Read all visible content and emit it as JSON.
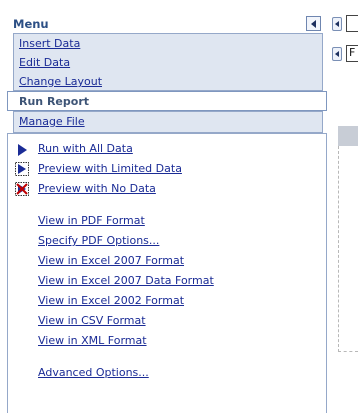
{
  "menu": {
    "title": "Menu",
    "items": [
      {
        "label": "Insert Data"
      },
      {
        "label": "Edit Data"
      },
      {
        "label": "Change Layout"
      }
    ],
    "run_report": {
      "label": "Run Report"
    },
    "manage_file": {
      "label": "Manage File"
    }
  },
  "run_report_options": {
    "run": [
      {
        "label": "Run with All Data",
        "icon": "play-icon"
      },
      {
        "label": "Preview with Limited Data",
        "icon": "preview-limited-icon"
      },
      {
        "label": "Preview with No Data",
        "icon": "preview-no-data-icon"
      }
    ],
    "formats": [
      {
        "label": "View in PDF Format"
      },
      {
        "label": "Specify PDF Options..."
      },
      {
        "label": "View in Excel 2007 Format"
      },
      {
        "label": "View in Excel 2007 Data Format"
      },
      {
        "label": "View in Excel 2002 Format"
      },
      {
        "label": "View in CSV Format"
      },
      {
        "label": "View in XML Format"
      }
    ],
    "advanced": {
      "label": "Advanced Options..."
    }
  },
  "right_panel": {
    "field_2_value": "F"
  },
  "colors": {
    "link": "#1b2c96",
    "menu_title": "#2c4f85",
    "menu_background": "#dfe6f1",
    "border": "#95a8c9"
  }
}
